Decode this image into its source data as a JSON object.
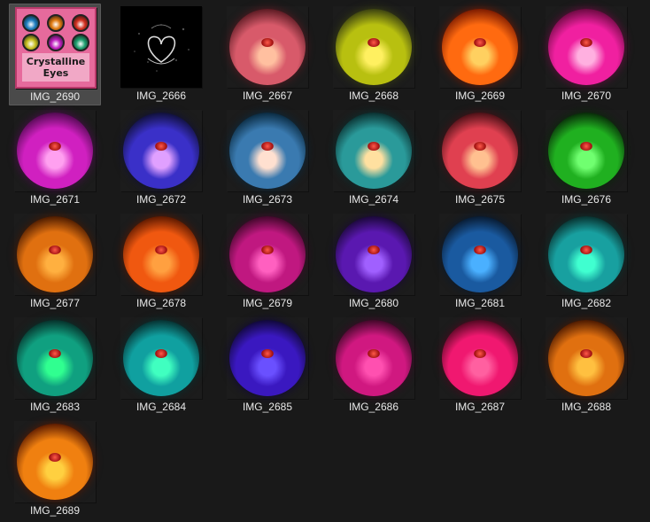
{
  "window": {
    "background": "#191919",
    "selection_color": "#4a4a4a"
  },
  "files": [
    {
      "name": "IMG_2690",
      "kind": "collage",
      "selected": true,
      "collage_text": "Crystalline\nEyes",
      "minis": [
        "#1f7fc0",
        "#e07a10",
        "#d43020",
        "#c8c020",
        "#c020c0",
        "#20a070"
      ]
    },
    {
      "name": "IMG_2666",
      "kind": "heart",
      "selected": false
    },
    {
      "name": "IMG_2667",
      "kind": "orb",
      "hue": "#d85a6a",
      "rim": "#5a1a22",
      "glow": "#ffc0a0"
    },
    {
      "name": "IMG_2668",
      "kind": "orb",
      "hue": "#b8c010",
      "rim": "#3a4010",
      "glow": "#fff060"
    },
    {
      "name": "IMG_2669",
      "kind": "orb",
      "hue": "#ff6a10",
      "rim": "#7a1a00",
      "glow": "#ffd060"
    },
    {
      "name": "IMG_2670",
      "kind": "orb",
      "hue": "#f020a0",
      "rim": "#6a0a40",
      "glow": "#ffb0e0"
    },
    {
      "name": "IMG_2671",
      "kind": "orb",
      "hue": "#d020c0",
      "rim": "#500a50",
      "glow": "#ffa0f0"
    },
    {
      "name": "IMG_2672",
      "kind": "orb",
      "hue": "#3a30c8",
      "rim": "#10103a",
      "glow": "#e0a0ff"
    },
    {
      "name": "IMG_2673",
      "kind": "orb",
      "hue": "#3a7ab0",
      "rim": "#0a2a40",
      "glow": "#ffe0d0"
    },
    {
      "name": "IMG_2674",
      "kind": "orb",
      "hue": "#2a9a9a",
      "rim": "#0a3030",
      "glow": "#ffe0a0"
    },
    {
      "name": "IMG_2675",
      "kind": "orb",
      "hue": "#e04050",
      "rim": "#4a1016",
      "glow": "#ffc090"
    },
    {
      "name": "IMG_2676",
      "kind": "orb",
      "hue": "#20b020",
      "rim": "#082a08",
      "glow": "#70ff70"
    },
    {
      "name": "IMG_2677",
      "kind": "orb",
      "hue": "#e07010",
      "rim": "#4a1a00",
      "glow": "#ffb040"
    },
    {
      "name": "IMG_2678",
      "kind": "orb",
      "hue": "#f05810",
      "rim": "#5a1800",
      "glow": "#ffa040"
    },
    {
      "name": "IMG_2679",
      "kind": "orb",
      "hue": "#c01880",
      "rim": "#40082a",
      "glow": "#ff60c0"
    },
    {
      "name": "IMG_2680",
      "kind": "orb",
      "hue": "#5a18b0",
      "rim": "#1a0838",
      "glow": "#a060ff"
    },
    {
      "name": "IMG_2681",
      "kind": "orb",
      "hue": "#1a5aa0",
      "rim": "#081a30",
      "glow": "#4ab0ff"
    },
    {
      "name": "IMG_2682",
      "kind": "orb",
      "hue": "#18a0a0",
      "rim": "#08302e",
      "glow": "#40ffd0"
    },
    {
      "name": "IMG_2683",
      "kind": "orb",
      "hue": "#10a080",
      "rim": "#06302a",
      "glow": "#30ff90"
    },
    {
      "name": "IMG_2684",
      "kind": "orb",
      "hue": "#10a0a0",
      "rim": "#063030",
      "glow": "#40ffc0"
    },
    {
      "name": "IMG_2685",
      "kind": "orb",
      "hue": "#3a18c0",
      "rim": "#100838",
      "glow": "#6a50ff"
    },
    {
      "name": "IMG_2686",
      "kind": "orb",
      "hue": "#d01880",
      "rim": "#400828",
      "glow": "#ff50b0"
    },
    {
      "name": "IMG_2687",
      "kind": "orb",
      "hue": "#f01870",
      "rim": "#500820",
      "glow": "#ff60a0"
    },
    {
      "name": "IMG_2688",
      "kind": "orb",
      "hue": "#e07010",
      "rim": "#4a1800",
      "glow": "#ffc040"
    },
    {
      "name": "IMG_2689",
      "kind": "orb",
      "hue": "#f08010",
      "rim": "#5a1a00",
      "glow": "#ffd040"
    }
  ]
}
